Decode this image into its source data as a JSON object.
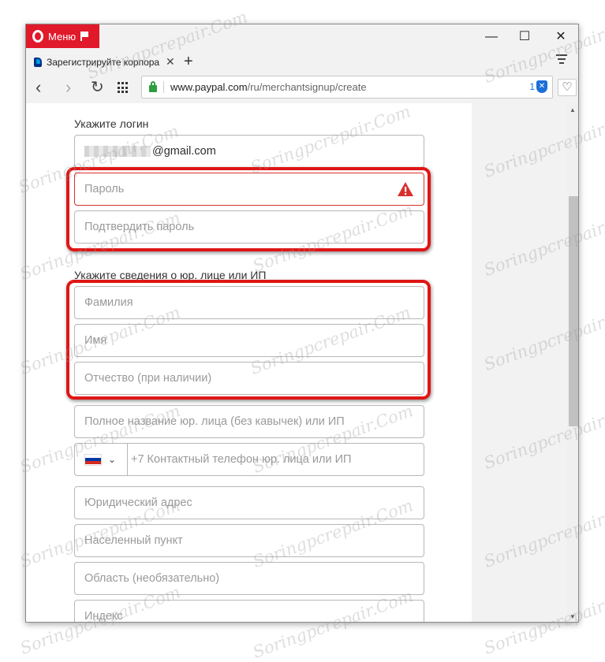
{
  "browser": {
    "menu_label": "Меню",
    "tab_title": "Зарегистрируйте корпора",
    "tab_close": "✕",
    "new_tab": "+",
    "window_controls": {
      "minimize": "—",
      "maximize": "☐",
      "close": "✕"
    },
    "nav": {
      "back": "‹",
      "forward": "›",
      "reload": "↻"
    },
    "url_host": "www.paypal.com",
    "url_path": "/ru/merchantsignup/create",
    "blocked_count": "1",
    "icons": [
      "opera-logo-icon",
      "flag-icon",
      "paypal-favicon",
      "tab-menu-icon",
      "speed-dial-grid-icon",
      "lock-icon",
      "ad-block-shield-icon",
      "heart-icon"
    ]
  },
  "form": {
    "login_label": "Укажите логин",
    "email_suffix": "@gmail.com",
    "password_placeholder": "Пароль",
    "confirm_password_placeholder": "Подтвердить пароль",
    "company_section_label": "Укажите сведения о юр. лице или ИП",
    "last_name_placeholder": "Фамилия",
    "first_name_placeholder": "Имя",
    "middle_name_placeholder": "Отчество (при наличии)",
    "company_name_placeholder": "Полное название юр. лица (без кавычек) или ИП",
    "phone_placeholder": "+7 Контактный телефон юр. лица или ИП",
    "country_chevron": "⌄",
    "legal_address_placeholder": "Юридический адрес",
    "city_placeholder": "Населенный пункт",
    "region_placeholder": "Область (необязательно)",
    "postal_code_placeholder": "Индекс"
  },
  "colors": {
    "opera_red": "#e0192b",
    "highlight_red": "#e01515",
    "warning_red": "#d9302c",
    "secure_green": "#2e9e3e",
    "flag_white": "#ffffff",
    "flag_blue": "#0039a6",
    "flag_red": "#d52b1e"
  },
  "watermark": "Soringpcrepair.Com"
}
